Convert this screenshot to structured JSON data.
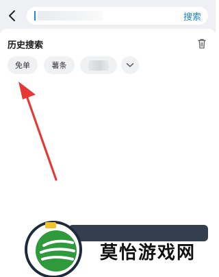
{
  "header": {
    "search_input_value": "",
    "search_action_label": "搜索"
  },
  "history": {
    "title": "历史搜索",
    "chips": [
      {
        "label": "免单"
      },
      {
        "label": "薯条"
      },
      {
        "label": ""
      }
    ]
  },
  "watermark": {
    "text": "莫怡游戏网"
  },
  "colors": {
    "accent": "#1f86e5",
    "annotation_arrow": "#e53935",
    "chip_bg": "#f0f1f3",
    "band_bg": "#eef0f4"
  },
  "icons": [
    "back-arrow-icon",
    "trash-icon",
    "chevron-down-icon",
    "site-logo-icon"
  ]
}
